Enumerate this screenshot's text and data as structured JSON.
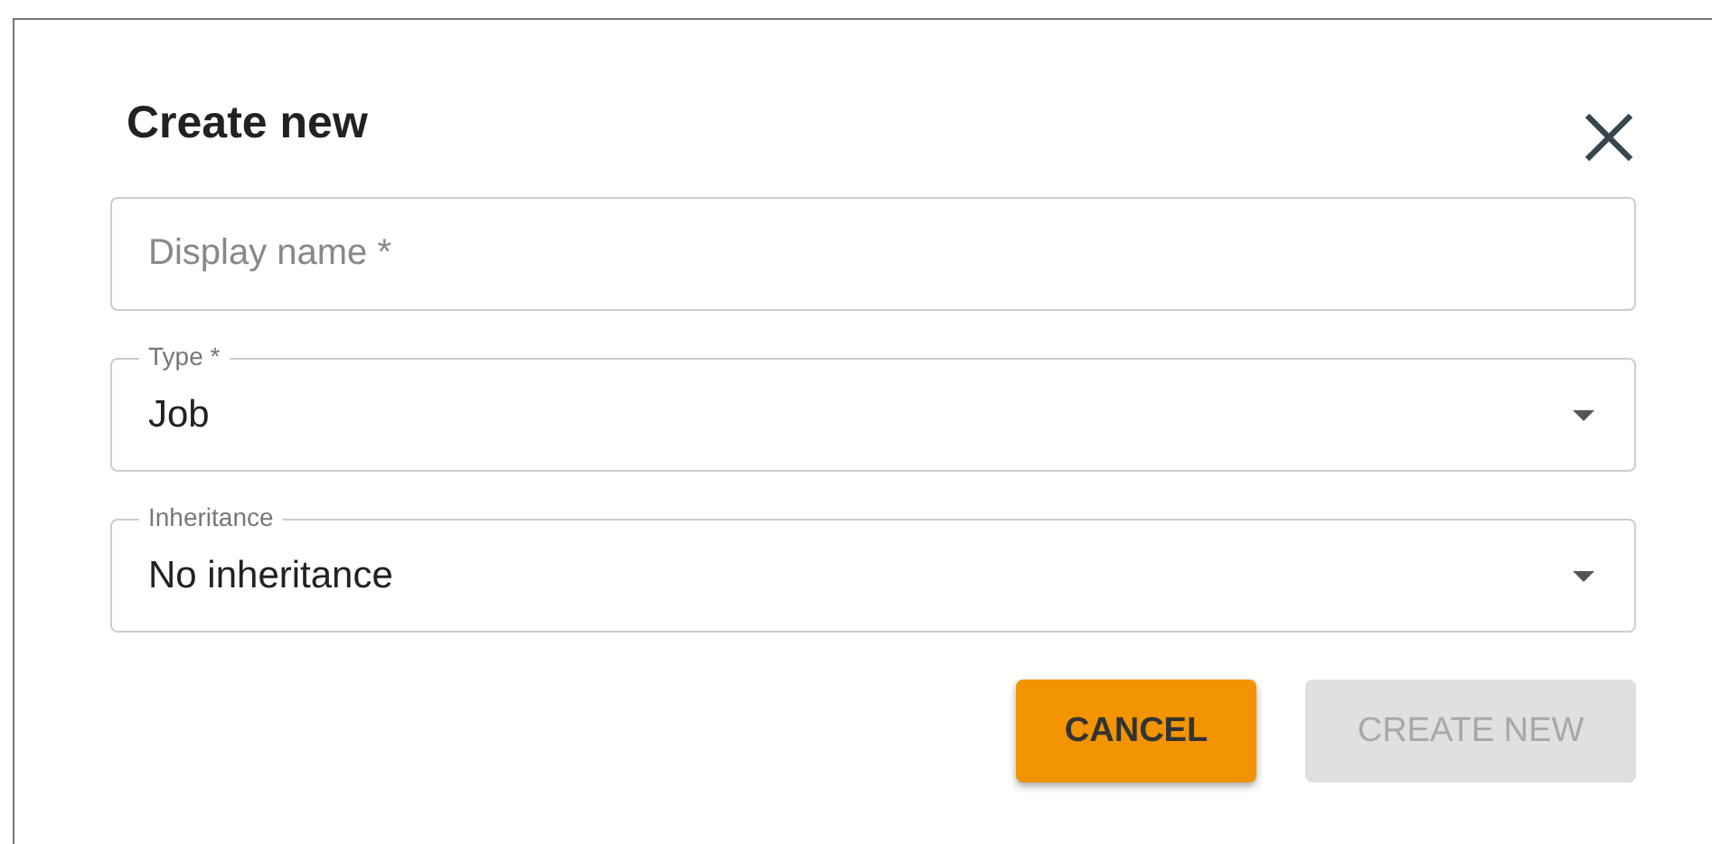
{
  "dialog": {
    "title": "Create new"
  },
  "fields": [
    {
      "kind": "text",
      "placeholder": "Display name *"
    },
    {
      "kind": "select",
      "label": "Type *",
      "value": "Job"
    },
    {
      "kind": "select",
      "label": "Inheritance",
      "value": "No inheritance"
    }
  ],
  "buttons": [
    {
      "label": "CANCEL",
      "kind": "primary",
      "disabled": false
    },
    {
      "label": "CREATE NEW",
      "kind": "primary",
      "disabled": true
    }
  ]
}
